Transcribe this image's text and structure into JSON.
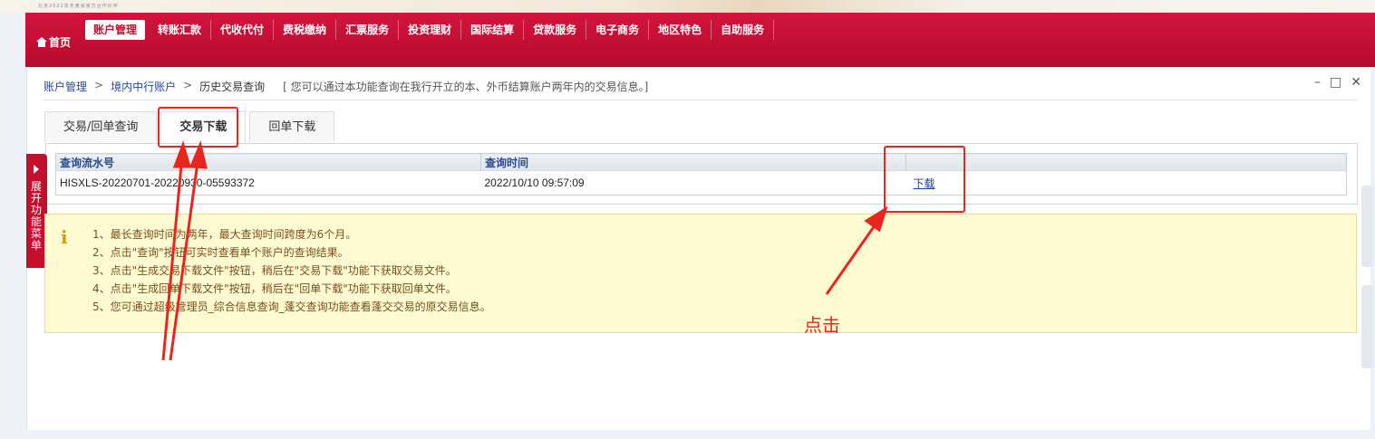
{
  "banner": {
    "text": "北京2022年冬奥会官方合作伙伴"
  },
  "nav": {
    "home_label": "首页",
    "items": [
      {
        "label": "账户管理",
        "active": true
      },
      {
        "label": "转账汇款"
      },
      {
        "label": "代收代付"
      },
      {
        "label": "费税缴纳"
      },
      {
        "label": "汇票服务"
      },
      {
        "label": "投资理财"
      },
      {
        "label": "国际结算"
      },
      {
        "label": "贷款服务"
      },
      {
        "label": "电子商务"
      },
      {
        "label": "地区特色"
      },
      {
        "label": "自助服务"
      }
    ]
  },
  "breadcrumb": {
    "level1": "账户管理",
    "level2": "境内中行账户",
    "level3": "历史交易查询",
    "separator": ">",
    "hint": "[ 您可以通过本功能查询在我行开立的本、外币结算账户两年内的交易信息。]"
  },
  "window_controls": {
    "minimize": "–",
    "maximize": "□",
    "close": "✕"
  },
  "tabs": [
    {
      "label": "交易/回单查询"
    },
    {
      "label": "交易下载",
      "active": true
    },
    {
      "label": "回单下载"
    }
  ],
  "grid": {
    "headers": [
      "查询流水号",
      "查询时间",
      ""
    ],
    "rows": [
      {
        "serial": "HISXLS-20220701-20220930-05593372",
        "time": "2022/10/10 09:57:09",
        "action": "下载"
      }
    ]
  },
  "side_tab": {
    "label": "展开功能菜单"
  },
  "info": {
    "icon": "info-icon",
    "lines": [
      "1、最长查询时间为两年，最大查询时间跨度为6个月。",
      "2、点击\"查询\"按钮可实时查看单个账户的查询结果。",
      "3、点击\"生成交易下载文件\"按钮，稍后在\"交易下载\"功能下获取交易文件。",
      "4、点击\"生成回单下载文件\"按钮，稍后在\"回单下载\"功能下获取回单文件。",
      "5、您可通过超级管理员_综合信息查询_蓬交查询功能查看蓬交交易的原交易信息。"
    ]
  },
  "annotation": {
    "click_text": "点击",
    "color": "#e8251f"
  },
  "colors": {
    "brand": "#c10e32",
    "link": "#1a3d8f",
    "info_bg": "#fefbd3"
  }
}
